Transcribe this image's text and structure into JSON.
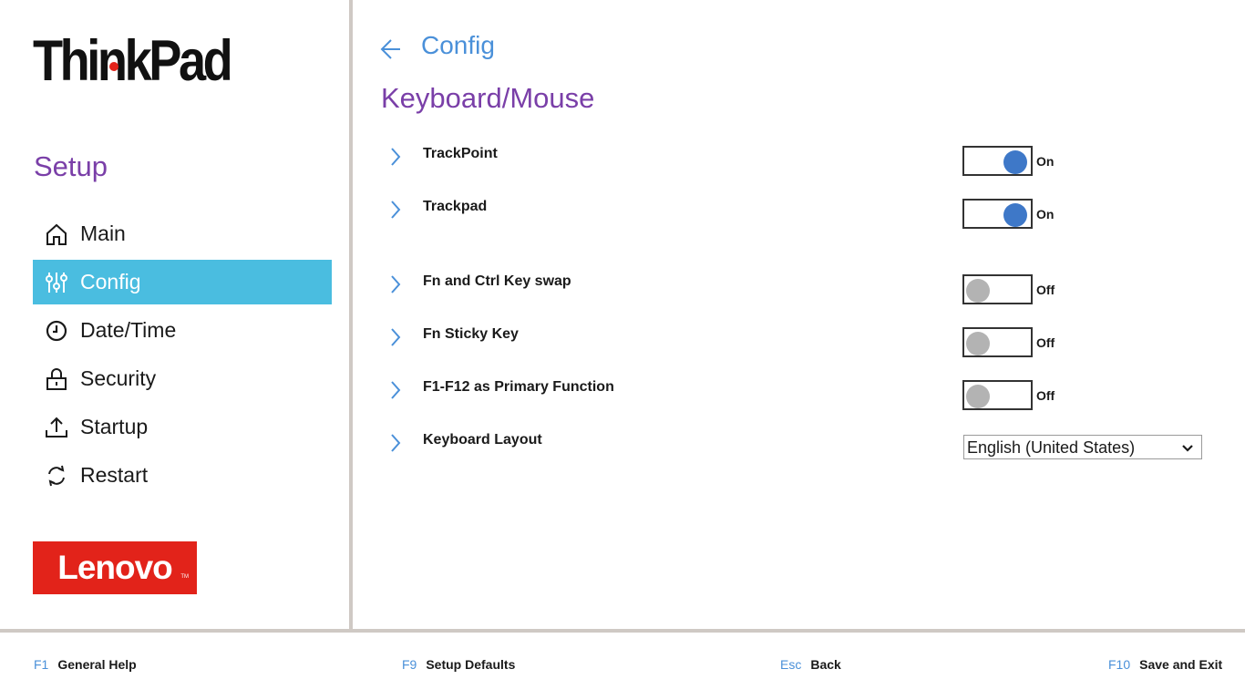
{
  "sidebar": {
    "brand": "ThinkPad",
    "title": "Setup",
    "items": [
      {
        "label": "Main",
        "icon": "home-icon",
        "active": false
      },
      {
        "label": "Config",
        "icon": "sliders-icon",
        "active": true
      },
      {
        "label": "Date/Time",
        "icon": "clock-icon",
        "active": false
      },
      {
        "label": "Security",
        "icon": "lock-icon",
        "active": false
      },
      {
        "label": "Startup",
        "icon": "upload-icon",
        "active": false
      },
      {
        "label": "Restart",
        "icon": "restart-icon",
        "active": false
      }
    ],
    "logo": "Lenovo",
    "logo_tm": "TM"
  },
  "main": {
    "breadcrumb": "Config",
    "title": "Keyboard/Mouse",
    "settings": [
      {
        "label": "TrackPoint",
        "state": "On"
      },
      {
        "label": "Trackpad",
        "state": "On"
      },
      {
        "label": "Fn and Ctrl Key swap",
        "state": "Off"
      },
      {
        "label": "Fn Sticky Key",
        "state": "Off"
      },
      {
        "label": "F1-F12 as Primary Function",
        "state": "Off"
      },
      {
        "label": "Keyboard Layout",
        "value": "English (United States)"
      }
    ]
  },
  "footer": [
    {
      "key": "F1",
      "label": "General Help"
    },
    {
      "key": "F9",
      "label": "Setup Defaults"
    },
    {
      "key": "Esc",
      "label": "Back"
    },
    {
      "key": "F10",
      "label": "Save and Exit"
    }
  ],
  "colors": {
    "accent_purple": "#7a3fa8",
    "accent_blue": "#4a90d9",
    "active_nav": "#4abde0",
    "toggle_on": "#3e78c8",
    "toggle_off": "#b3b3b3",
    "lenovo_red": "#e2231a"
  }
}
